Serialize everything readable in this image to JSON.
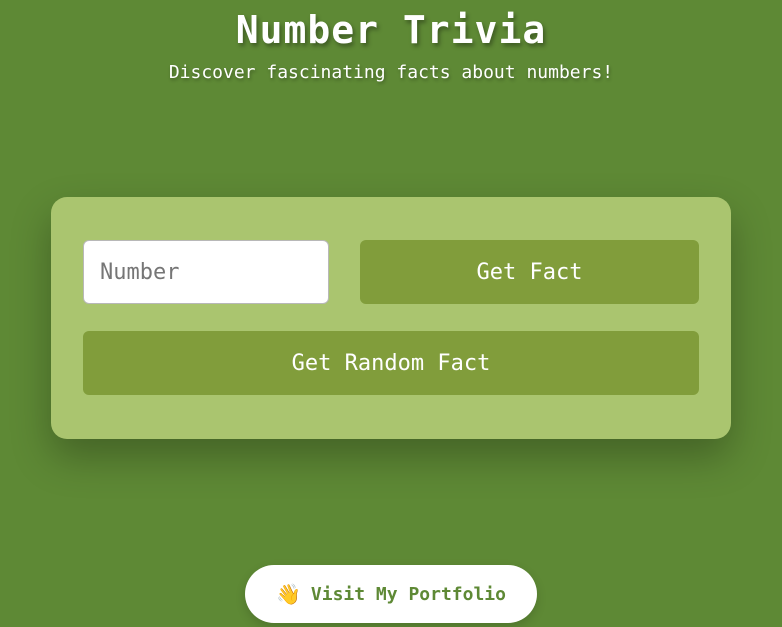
{
  "header": {
    "title": "Number Trivia",
    "subtitle": "Discover fascinating facts about numbers!"
  },
  "form": {
    "number_placeholder": "Number",
    "number_value": "",
    "get_fact_label": "Get Fact",
    "random_fact_label": "Get Random Fact"
  },
  "footer": {
    "portfolio_icon": "👋",
    "portfolio_label": "Visit My Portfolio"
  },
  "colors": {
    "background": "#5e8935",
    "card": "#aac56f",
    "button": "#819d3b",
    "text": "#ffffff"
  }
}
